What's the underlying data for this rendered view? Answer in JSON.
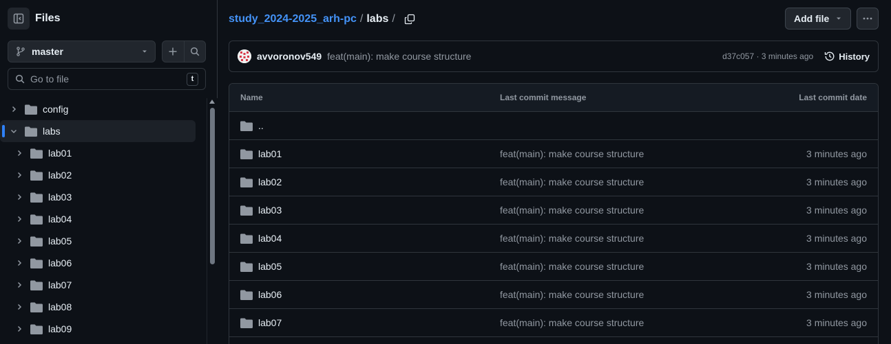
{
  "sidebar": {
    "title": "Files",
    "branch": "master",
    "search_placeholder": "Go to file",
    "shortcut_key": "t",
    "tree": [
      {
        "name": "config",
        "expanded": false,
        "level": 0
      },
      {
        "name": "labs",
        "expanded": true,
        "level": 0,
        "active": true
      },
      {
        "name": "lab01",
        "expanded": false,
        "level": 1
      },
      {
        "name": "lab02",
        "expanded": false,
        "level": 1
      },
      {
        "name": "lab03",
        "expanded": false,
        "level": 1
      },
      {
        "name": "lab04",
        "expanded": false,
        "level": 1
      },
      {
        "name": "lab05",
        "expanded": false,
        "level": 1
      },
      {
        "name": "lab06",
        "expanded": false,
        "level": 1
      },
      {
        "name": "lab07",
        "expanded": false,
        "level": 1
      },
      {
        "name": "lab08",
        "expanded": false,
        "level": 1
      },
      {
        "name": "lab09",
        "expanded": false,
        "level": 1
      }
    ]
  },
  "header": {
    "repo": "study_2024-2025_arh-pc",
    "separator": "/",
    "current": "labs",
    "trailing_sep": "/",
    "add_file_label": "Add file"
  },
  "commit": {
    "author": "avvoronov549",
    "message": "feat(main): make course structure",
    "meta": "d37c057 · 3 minutes ago",
    "history_label": "History"
  },
  "table": {
    "headers": {
      "name": "Name",
      "message": "Last commit message",
      "date": "Last commit date"
    },
    "parent": "..",
    "rows": [
      {
        "name": "lab01",
        "message": "feat(main): make course structure",
        "date": "3 minutes ago"
      },
      {
        "name": "lab02",
        "message": "feat(main): make course structure",
        "date": "3 minutes ago"
      },
      {
        "name": "lab03",
        "message": "feat(main): make course structure",
        "date": "3 minutes ago"
      },
      {
        "name": "lab04",
        "message": "feat(main): make course structure",
        "date": "3 minutes ago"
      },
      {
        "name": "lab05",
        "message": "feat(main): make course structure",
        "date": "3 minutes ago"
      },
      {
        "name": "lab06",
        "message": "feat(main): make course structure",
        "date": "3 minutes ago"
      },
      {
        "name": "lab07",
        "message": "feat(main): make course structure",
        "date": "3 minutes ago"
      }
    ]
  },
  "colors": {
    "background": "#0d1117",
    "border": "#30363d",
    "link": "#4493f8",
    "muted": "#9198a1",
    "folder": "#9198a1",
    "active_marker": "#2f81f7"
  }
}
